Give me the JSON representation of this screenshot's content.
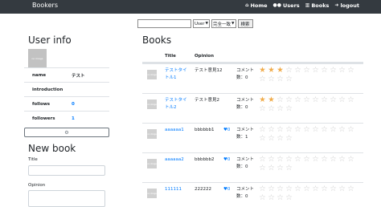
{
  "nav": {
    "brand": "Bookers",
    "links": [
      {
        "icon": "home-icon",
        "label": "Home"
      },
      {
        "icon": "users-icon",
        "label": "Users"
      },
      {
        "icon": "book-icon",
        "label": "Books"
      },
      {
        "icon": "logout-icon",
        "label": "logout"
      }
    ]
  },
  "search": {
    "query": "",
    "target": "User",
    "method": "完全一致",
    "button": "検索"
  },
  "user_info": {
    "heading": "User info",
    "avatar_text": "no image",
    "rows": [
      {
        "label": "name",
        "value": "テスト"
      },
      {
        "label": "introduction",
        "value": ""
      },
      {
        "label": "follows",
        "value": "0"
      },
      {
        "label": "followers",
        "value": "1"
      }
    ]
  },
  "new_book": {
    "heading": "New book",
    "title_label": "Title",
    "opinion_label": "Opinion"
  },
  "books": {
    "heading": "Books",
    "columns": [
      "",
      "Title",
      "Opinion",
      "",
      ""
    ],
    "rows": [
      {
        "title": "テストタイトル1",
        "opinion": "テスト意見12",
        "favorites": "",
        "comment": "コメント数：0",
        "rating": 3
      },
      {
        "title": "テストタイトル2",
        "opinion": "テスト意見2",
        "favorites": "",
        "comment": "コメント数：0",
        "rating": 2
      },
      {
        "title": "aaaaaa1",
        "opinion": "bbbbbb1",
        "favorites": "♥0",
        "comment": "コメント数：1",
        "rating": 0
      },
      {
        "title": "aaaaaa2",
        "opinion": "bbbbbb2",
        "favorites": "♥0",
        "comment": "コメント数：0",
        "rating": 0
      },
      {
        "title": "111111",
        "opinion": "222222",
        "favorites": "♥0",
        "comment": "コメント数：0",
        "rating": 0
      }
    ]
  },
  "colors": {
    "navbar": "#343a40",
    "link": "#007bff",
    "star_on": "#f0ad4e",
    "star_off": "#c8c8c8"
  }
}
